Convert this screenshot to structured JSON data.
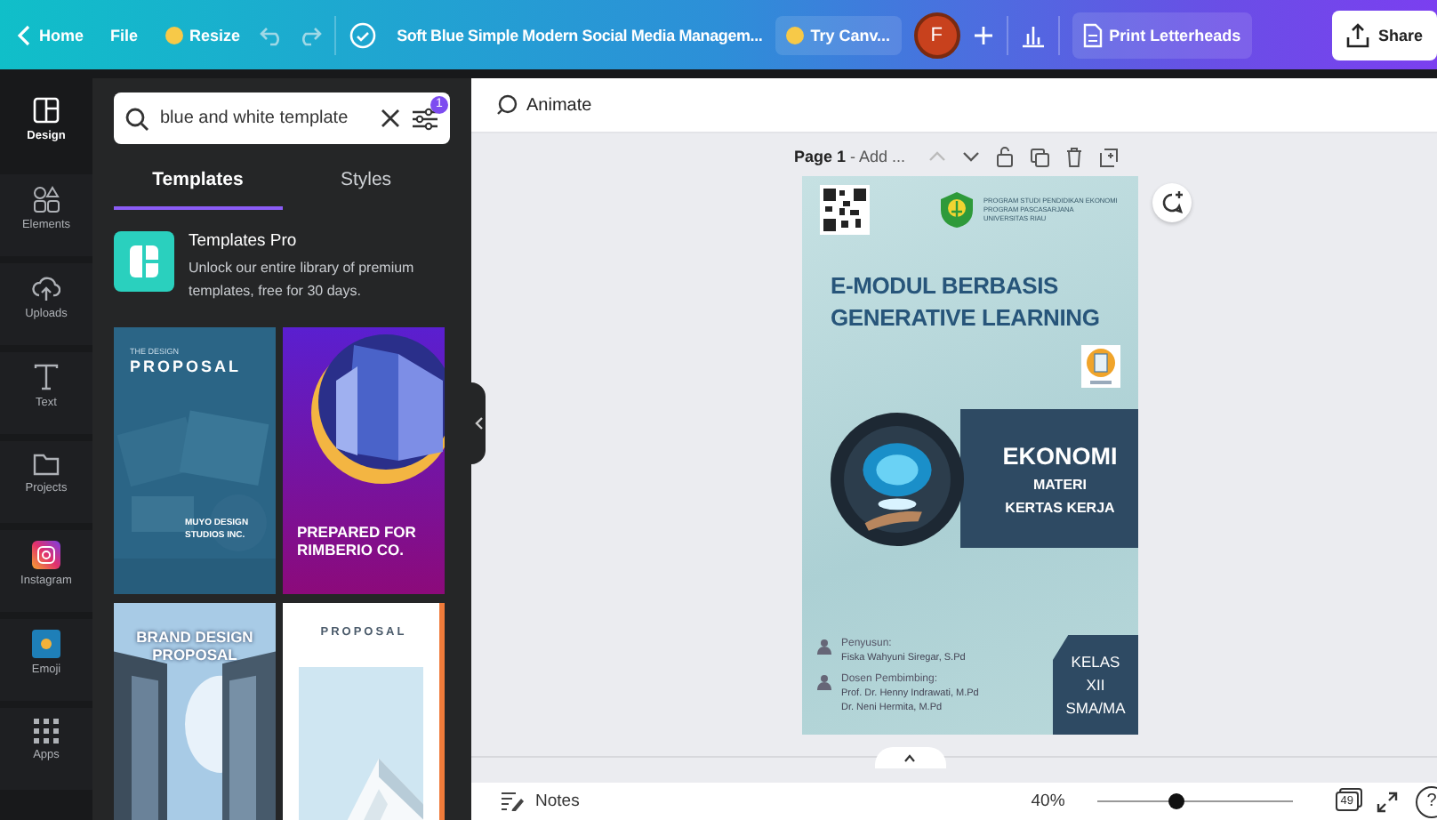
{
  "topbar": {
    "home": "Home",
    "file": "File",
    "resize": "Resize",
    "title": "Soft Blue Simple Modern Social Media Managem...",
    "try": "Try Canv...",
    "avatar": "F",
    "print": "Print Letterheads",
    "share": "Share"
  },
  "rail": [
    {
      "label": "Design",
      "kind": "design",
      "selected": true
    },
    {
      "label": "Elements",
      "kind": "elements",
      "selected": false
    },
    {
      "label": "Uploads",
      "kind": "uploads",
      "selected": false
    },
    {
      "label": "Text",
      "kind": "text",
      "selected": false
    },
    {
      "label": "Projects",
      "kind": "projects",
      "selected": false
    },
    {
      "label": "Instagram",
      "kind": "instagram",
      "selected": false
    },
    {
      "label": "Emoji",
      "kind": "emoji",
      "selected": false
    },
    {
      "label": "Apps",
      "kind": "apps",
      "selected": false
    }
  ],
  "search": {
    "value": "blue and white template",
    "filter_badge": "1"
  },
  "panel_tabs": [
    {
      "label": "Templates",
      "selected": true
    },
    {
      "label": "Styles",
      "selected": false
    }
  ],
  "promo": {
    "title": "Templates Pro",
    "text": "Unlock our entire library of premium templates, free for 30 days."
  },
  "templates": [
    {
      "kind": "blue",
      "kicker": "THE DESIGN",
      "heading": "PROPOSAL",
      "footer": "MUYO DESIGN STUDIOS INC."
    },
    {
      "kind": "purple",
      "heading": "PREPARED FOR RIMBERIO CO."
    },
    {
      "kind": "building",
      "heading": "BRAND DESIGN PROPOSAL"
    },
    {
      "kind": "white",
      "heading": "PROPOSAL"
    }
  ],
  "editor": {
    "animate": "Animate",
    "page_label": "Page 1",
    "page_hint": "- Add ..."
  },
  "design": {
    "institution": [
      "PROGRAM STUDI PENDIDIKAN EKONOMI",
      "PROGRAM PASCASARJANA",
      "UNIVERSITAS RIAU"
    ],
    "title": [
      "E-MODUL BERBASIS",
      "GENERATIVE LEARNING"
    ],
    "subject": "EKONOMI",
    "materi": [
      "MATERI",
      "KERTAS KERJA"
    ],
    "author_label": "Penyusun:",
    "author": "Fiska Wahyuni Siregar, S.Pd",
    "advisor_label": "Dosen Pembimbing:",
    "advisors": [
      "Prof. Dr. Henny Indrawati, M.Pd",
      "Dr. Neni Hermita, M.Pd"
    ],
    "grade": [
      "KELAS",
      "XII",
      "SMA/MA"
    ]
  },
  "footer": {
    "notes": "Notes",
    "zoom": "40%",
    "zoom_slider": {
      "level": 0.4
    },
    "pages": "49",
    "help": "?"
  }
}
